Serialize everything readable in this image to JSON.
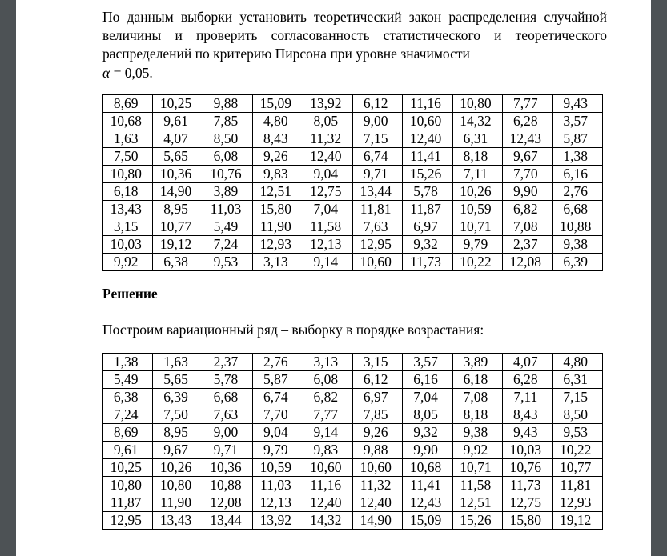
{
  "document": {
    "intro_paragraph": "По данным выборки установить теоретический закон распределения случайной величины и проверить согласованность статистического и теоретического распределений по критерию Пирсона при уровне значимости",
    "formula_alpha": "α",
    "formula_rest": " = 0,05.",
    "solution_heading": "Решение",
    "solution_intro": "Построим вариационный ряд – выборку в порядке возрастания:"
  },
  "sample_table": {
    "rows": [
      [
        "8,69",
        "10,25",
        "9,88",
        "15,09",
        "13,92",
        "6,12",
        "11,16",
        "10,80",
        "7,77",
        "9,43"
      ],
      [
        "10,68",
        "9,61",
        "7,85",
        "4,80",
        "8,05",
        "9,00",
        "10,60",
        "14,32",
        "6,28",
        "3,57"
      ],
      [
        "1,63",
        "4,07",
        "8,50",
        "8,43",
        "11,32",
        "7,15",
        "12,40",
        "6,31",
        "12,43",
        "5,87"
      ],
      [
        "7,50",
        "5,65",
        "6,08",
        "9,26",
        "12,40",
        "6,74",
        "11,41",
        "8,18",
        "9,67",
        "1,38"
      ],
      [
        "10,80",
        "10,36",
        "10,76",
        "9,83",
        "9,04",
        "9,71",
        "15,26",
        "7,11",
        "7,70",
        "6,16"
      ],
      [
        "6,18",
        "14,90",
        "3,89",
        "12,51",
        "12,75",
        "13,44",
        "5,78",
        "10,26",
        "9,90",
        "2,76"
      ],
      [
        "13,43",
        "8,95",
        "11,03",
        "15,80",
        "7,04",
        "11,81",
        "11,87",
        "10,59",
        "6,82",
        "6,68"
      ],
      [
        "3,15",
        "10,77",
        "5,49",
        "11,90",
        "11,58",
        "7,63",
        "6,97",
        "10,71",
        "7,08",
        "10,88"
      ],
      [
        "10,03",
        "19,12",
        "7,24",
        "12,93",
        "12,13",
        "12,95",
        "9,32",
        "9,79",
        "2,37",
        "9,38"
      ],
      [
        "9,92",
        "6,38",
        "9,53",
        "3,13",
        "9,14",
        "10,60",
        "11,73",
        "10,22",
        "12,08",
        "6,39"
      ]
    ]
  },
  "variation_series_table": {
    "rows": [
      [
        "1,38",
        "1,63",
        "2,37",
        "2,76",
        "3,13",
        "3,15",
        "3,57",
        "3,89",
        "4,07",
        "4,80"
      ],
      [
        "5,49",
        "5,65",
        "5,78",
        "5,87",
        "6,08",
        "6,12",
        "6,16",
        "6,18",
        "6,28",
        "6,31"
      ],
      [
        "6,38",
        "6,39",
        "6,68",
        "6,74",
        "6,82",
        "6,97",
        "7,04",
        "7,08",
        "7,11",
        "7,15"
      ],
      [
        "7,24",
        "7,50",
        "7,63",
        "7,70",
        "7,77",
        "7,85",
        "8,05",
        "8,18",
        "8,43",
        "8,50"
      ],
      [
        "8,69",
        "8,95",
        "9,00",
        "9,04",
        "9,14",
        "9,26",
        "9,32",
        "9,38",
        "9,43",
        "9,53"
      ],
      [
        "9,61",
        "9,67",
        "9,71",
        "9,79",
        "9,83",
        "9,88",
        "9,90",
        "9,92",
        "10,03",
        "10,22"
      ],
      [
        "10,25",
        "10,26",
        "10,36",
        "10,59",
        "10,60",
        "10,60",
        "10,68",
        "10,71",
        "10,76",
        "10,77"
      ],
      [
        "10,80",
        "10,80",
        "10,88",
        "11,03",
        "11,16",
        "11,32",
        "11,41",
        "11,58",
        "11,73",
        "11,81"
      ],
      [
        "11,87",
        "11,90",
        "12,08",
        "12,13",
        "12,40",
        "12,40",
        "12,43",
        "12,51",
        "12,75",
        "12,93"
      ],
      [
        "12,95",
        "13,43",
        "13,44",
        "13,92",
        "14,32",
        "14,90",
        "15,09",
        "15,26",
        "15,80",
        "19,12"
      ]
    ]
  },
  "colors": {
    "page_background": "#ffffff",
    "gutter": "#4d5255",
    "text": "#000000",
    "table_border": "#000000"
  }
}
